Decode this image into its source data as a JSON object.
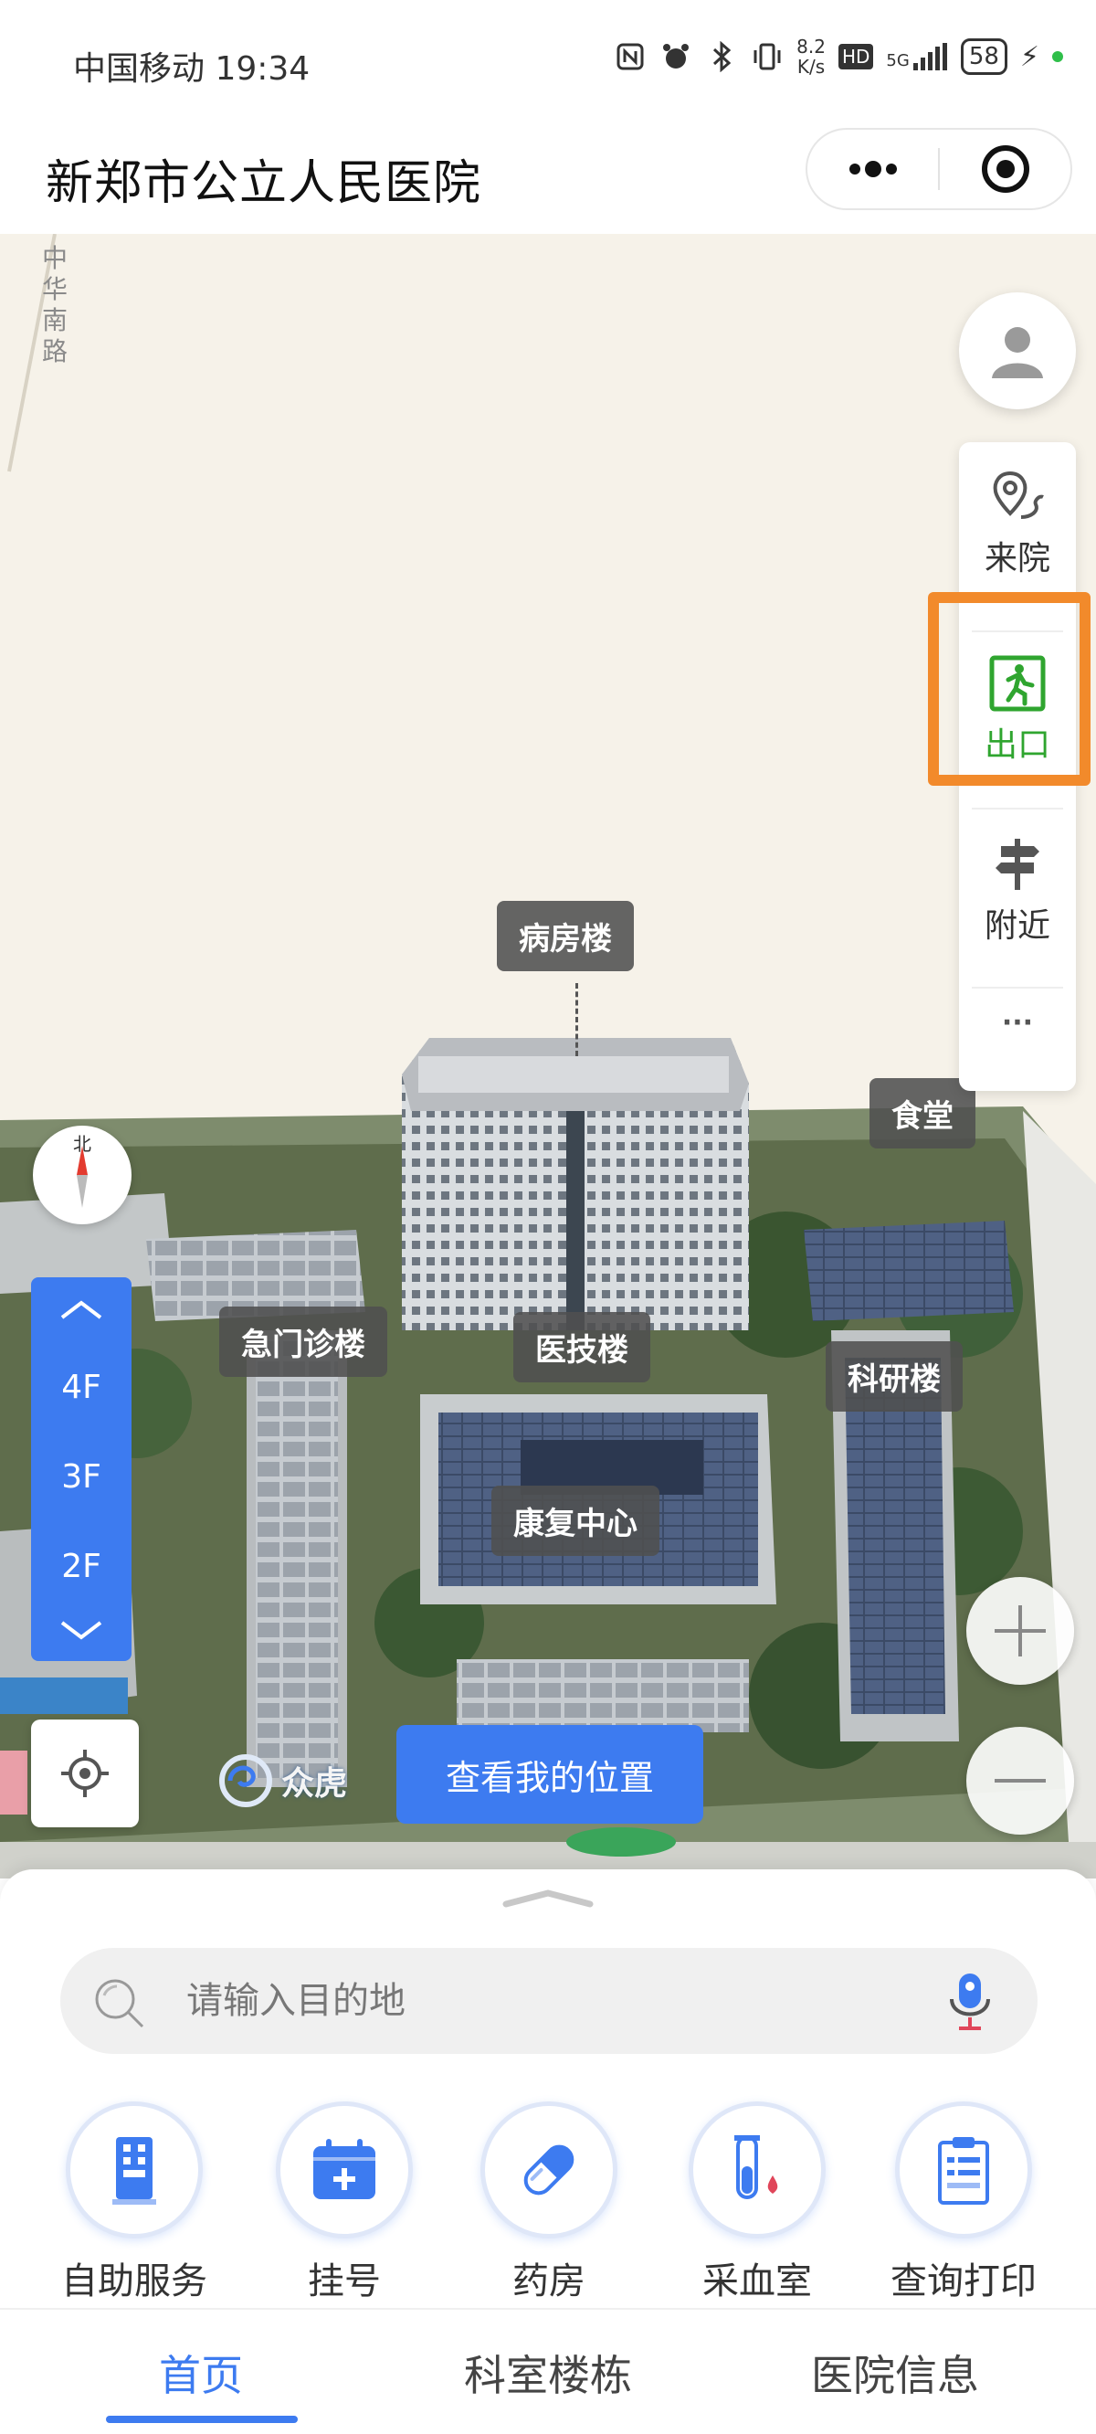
{
  "status_bar": {
    "carrier_time": "中国移动 19:34",
    "speed_value": "8.2",
    "speed_unit": "K/s",
    "hd": "HD",
    "network": "5G",
    "battery": "58"
  },
  "header": {
    "title": "新郑市公立人民医院",
    "icons": [
      "more-dots-icon",
      "target-circle-icon"
    ]
  },
  "map": {
    "street_label": "中华南路",
    "buildings": [
      "病房楼",
      "食堂",
      "急门诊楼",
      "医技楼",
      "科研楼",
      "康复中心"
    ],
    "compass_north": "北",
    "floors": [
      "4F",
      "3F",
      "2F"
    ],
    "side_panel": [
      {
        "label": "来院",
        "icon": "location-route-icon"
      },
      {
        "label": "出口",
        "icon": "exit-running-man-icon"
      },
      {
        "label": "附近",
        "icon": "signpost-icon"
      },
      {
        "label": "···",
        "icon": "more-icon"
      }
    ],
    "logo_text": "众虎",
    "my_position_button": "查看我的位置",
    "colors": {
      "accent": "#3d7bf0",
      "exit_green": "#2fa52f",
      "highlight": "#f28a2b"
    }
  },
  "sheet": {
    "search_placeholder": "请输入目的地",
    "quick_actions": [
      {
        "label": "自助服务",
        "icon": "kiosk-icon"
      },
      {
        "label": "挂号",
        "icon": "calendar-plus-icon"
      },
      {
        "label": "药房",
        "icon": "pill-capsule-icon"
      },
      {
        "label": "采血室",
        "icon": "test-tube-icon"
      },
      {
        "label": "查询打印",
        "icon": "clipboard-icon"
      }
    ]
  },
  "bottom_nav": {
    "tabs": [
      "首页",
      "科室楼栋",
      "医院信息"
    ],
    "active": "首页"
  }
}
